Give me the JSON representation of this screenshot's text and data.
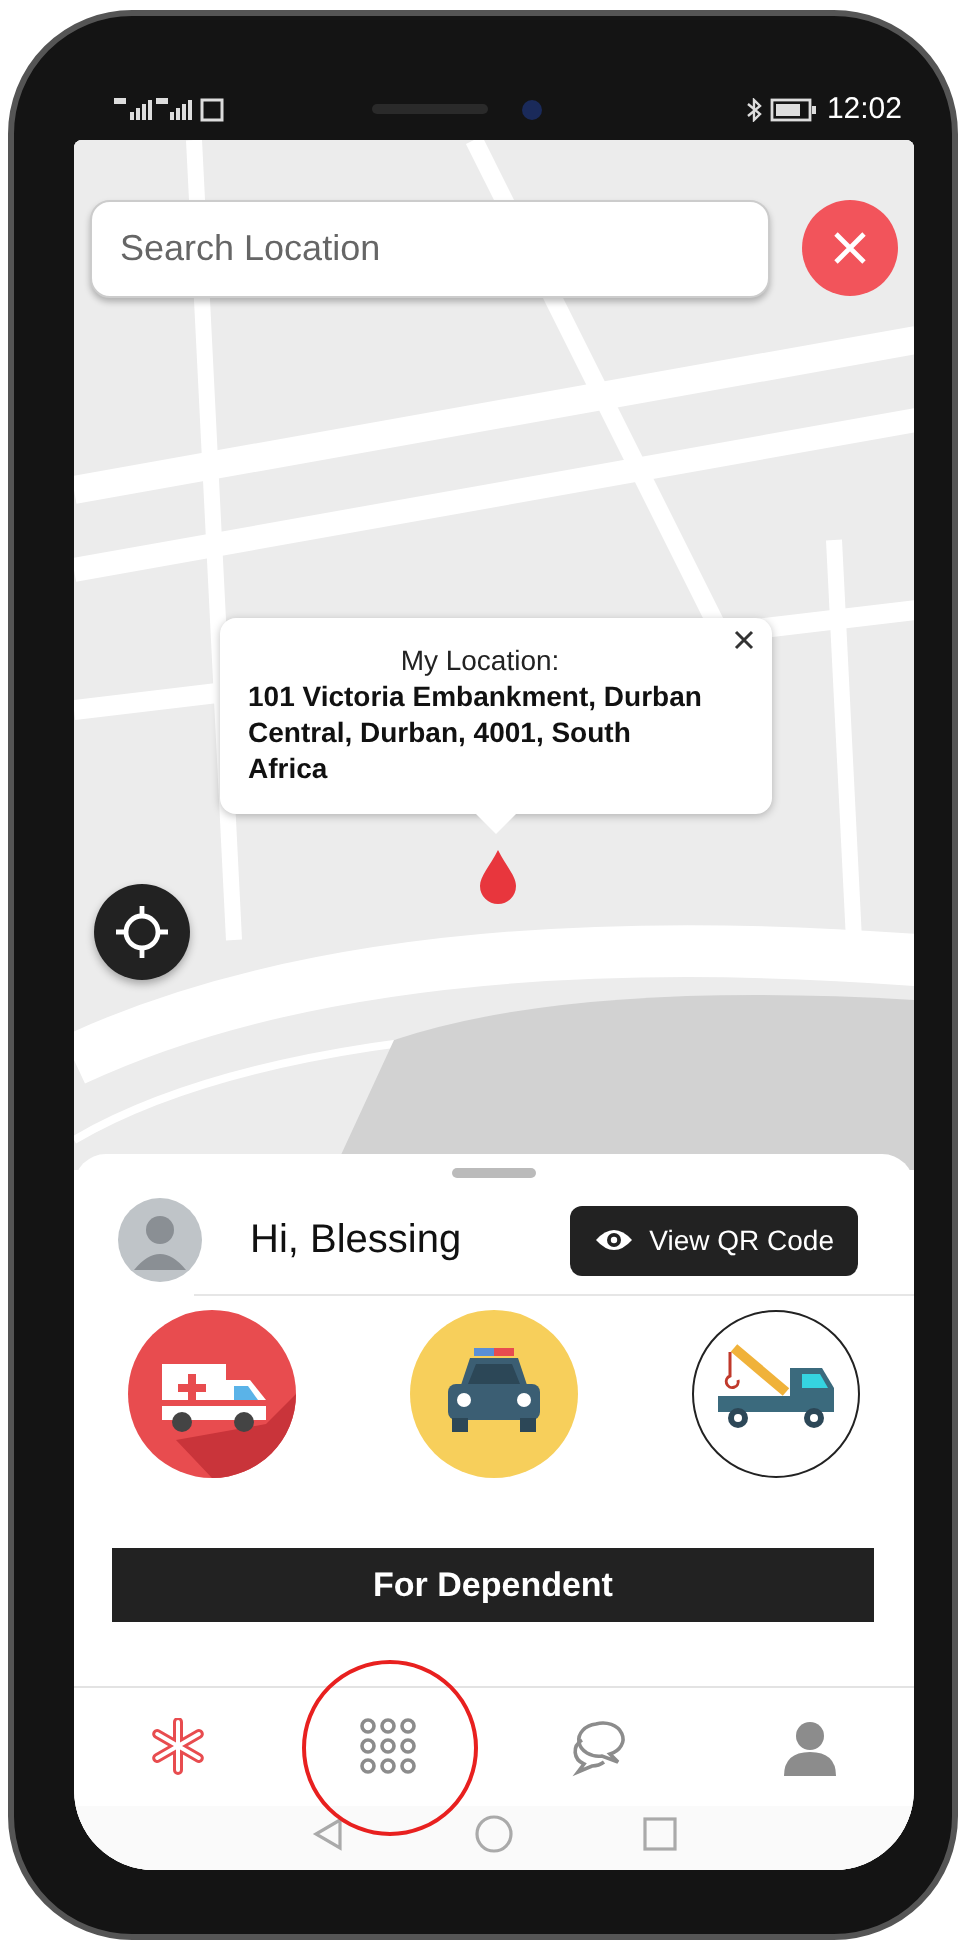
{
  "status_bar": {
    "time": "12:02"
  },
  "search": {
    "placeholder": "Search Location"
  },
  "location_popup": {
    "label": "My Location:",
    "address": "101 Victoria Embankment, Durban Central, Durban, 4001, South Africa"
  },
  "greeting": "Hi, Blessing",
  "qr_button": "View QR Code",
  "services": [
    {
      "kind": "ambulance"
    },
    {
      "kind": "police"
    },
    {
      "kind": "tow"
    }
  ],
  "dependent_button": "For Dependent",
  "nav": [
    {
      "kind": "emergency",
      "selected": true,
      "highlighted": false
    },
    {
      "kind": "apps",
      "selected": false,
      "highlighted": true
    },
    {
      "kind": "chat",
      "selected": false,
      "highlighted": false
    },
    {
      "kind": "profile",
      "selected": false,
      "highlighted": false
    }
  ]
}
